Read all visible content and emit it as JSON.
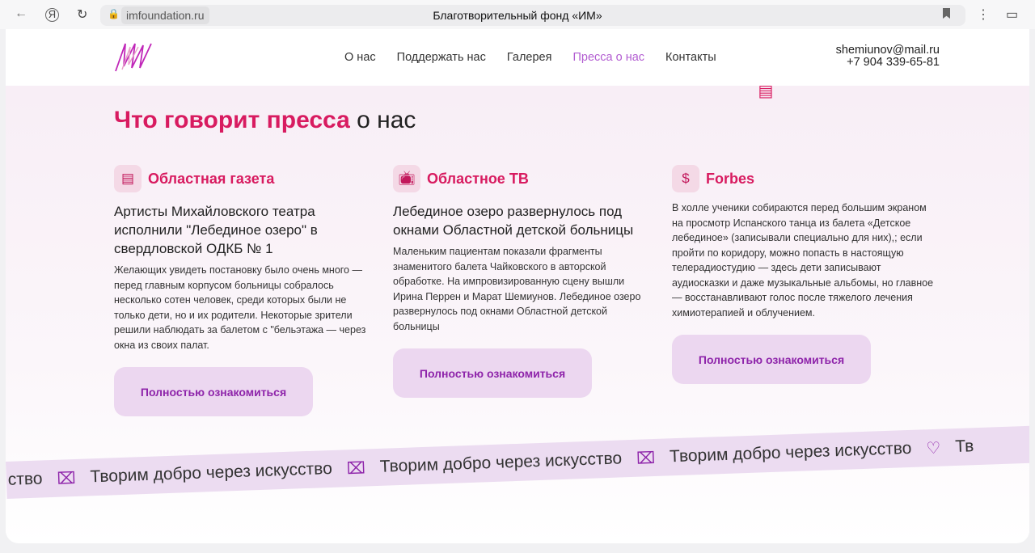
{
  "browser": {
    "url": "imfoundation.ru",
    "page_title": "Благотворительный фонд «ИМ»"
  },
  "nav": [
    "О нас",
    "Поддержать нас",
    "Галерея",
    "Пресса о нас",
    "Контакты"
  ],
  "contacts": {
    "email": "shemiunov@mail.ru",
    "phone": "+7 904 339-65-81"
  },
  "heading": {
    "accent": "Что говорит пресса",
    "rest": " о нас"
  },
  "cards": [
    {
      "source": "Областная газета",
      "headline": "Артисты Михайловского театра исполнили \"Лебединое озеро\" в свердловской ОДКБ № 1",
      "text": "Желающих увидеть постановку было очень много — перед главным корпусом больницы собралось несколько сотен человек, среди которых были не только дети, но и их родители. Некоторые зрители решили наблюдать за балетом с \"бельэтажа — через окна из своих палат.",
      "button": "Полностью ознакомиться"
    },
    {
      "source": "Областное ТВ",
      "headline": "Лебединое озеро развернулось под окнами Областной детской больницы",
      "text": "Маленьким пациентам показали фрагменты знаменитого балета Чайковского в авторской обработке. На импровизированную сцену вышли Ирина Перрен и Марат Шемиунов. Лебединое озеро развернулось под окнами Областной детской больницы",
      "button": "Полностью ознакомиться"
    },
    {
      "source": "Forbes",
      "headline": "",
      "text": "В холле ученики собираются перед большим экраном на просмотр Испанского танца из балета «Детское лебединое» (записывали специально для них),; если пройти по коридору, можно попасть в настоящую телерадиостудию — здесь дети записывают аудиосказки и даже музыкальные альбомы, но главное — восстанавливают голос после тяжелого лечения химиотерапией и облучением.",
      "button": "Полностью ознакомиться"
    }
  ],
  "ribbon": {
    "partial_start": "ство",
    "slogan": "Творим добро через искусство",
    "partial_end": "Тв"
  }
}
